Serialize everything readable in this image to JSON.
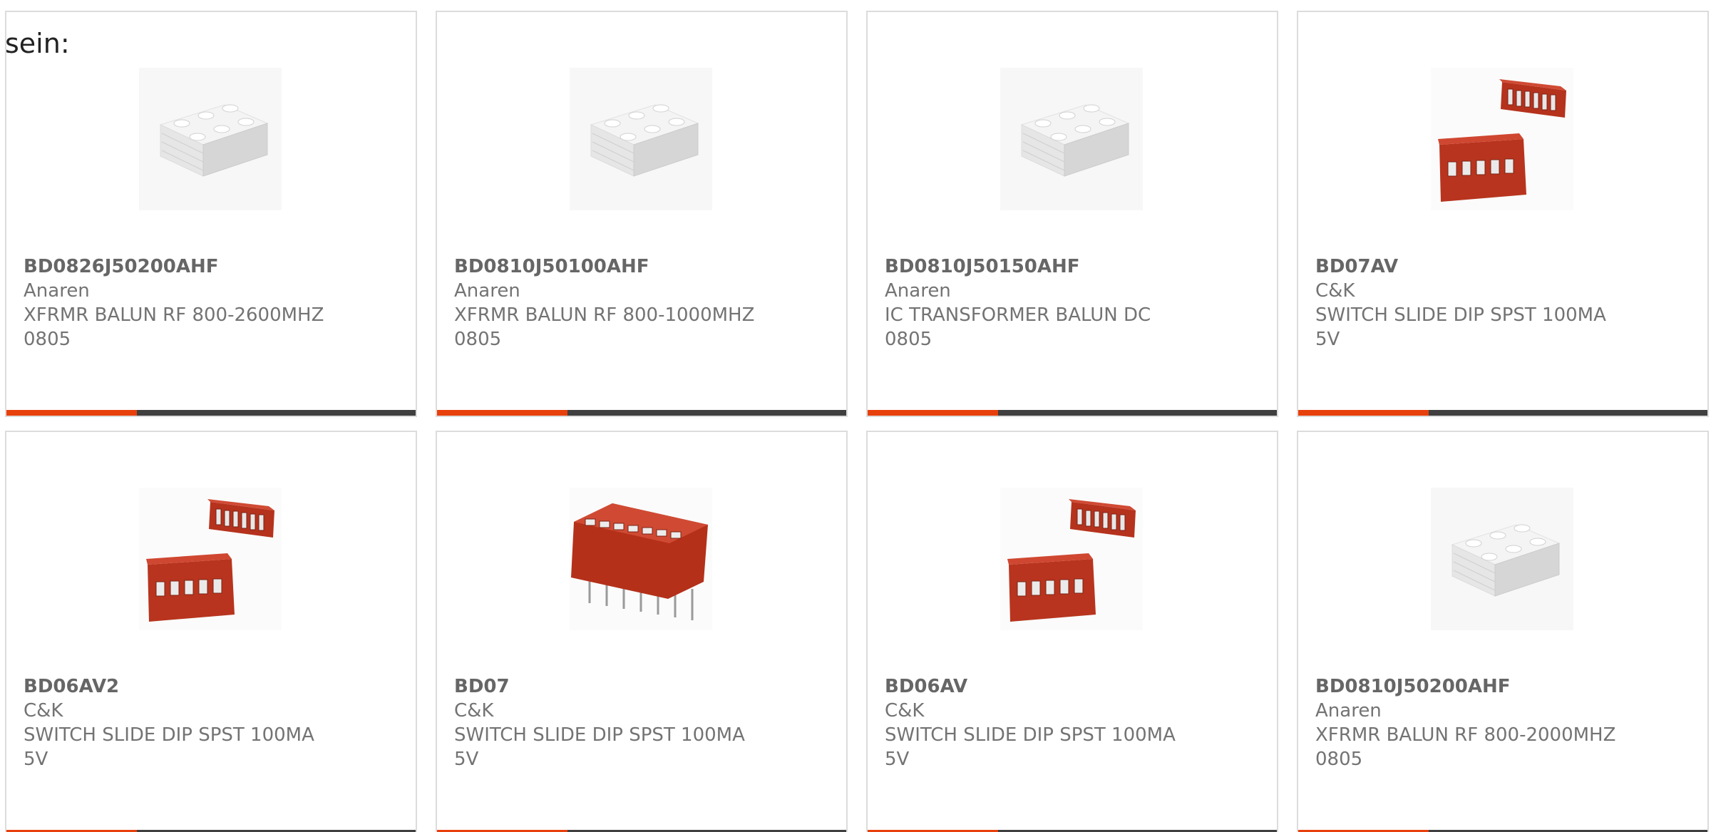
{
  "intro_text": "sein:",
  "colors": {
    "accent": "#e8400c",
    "bar": "#3f3f3f",
    "card_border": "#dcdcdc",
    "text": "#737373"
  },
  "products": [
    {
      "part_number": "BD0826J50200AHF",
      "manufacturer": "Anaren",
      "description_line1": "XFRMR BALUN RF 800-2600MHZ",
      "description_line2": "0805",
      "image": "balun-chip-image"
    },
    {
      "part_number": "BD0810J50100AHF",
      "manufacturer": "Anaren",
      "description_line1": "XFRMR BALUN RF 800-1000MHZ",
      "description_line2": "0805",
      "image": "balun-chip-image"
    },
    {
      "part_number": "BD0810J50150AHF",
      "manufacturer": "Anaren",
      "description_line1": "IC TRANSFORMER BALUN DC",
      "description_line2": "0805",
      "image": "balun-chip-image"
    },
    {
      "part_number": "BD07AV",
      "manufacturer": "C&K",
      "description_line1": "SWITCH SLIDE DIP SPST 100MA",
      "description_line2": "5V",
      "image": "dip-switch-pair-image"
    },
    {
      "part_number": "BD06AV2",
      "manufacturer": "C&K",
      "description_line1": "SWITCH SLIDE DIP SPST 100MA",
      "description_line2": "5V",
      "image": "dip-switch-pair-image"
    },
    {
      "part_number": "BD07",
      "manufacturer": "C&K",
      "description_line1": "SWITCH SLIDE DIP SPST 100MA",
      "description_line2": "5V",
      "image": "dip-switch-single-image"
    },
    {
      "part_number": "BD06AV",
      "manufacturer": "C&K",
      "description_line1": "SWITCH SLIDE DIP SPST 100MA",
      "description_line2": "5V",
      "image": "dip-switch-pair-image"
    },
    {
      "part_number": "BD0810J50200AHF",
      "manufacturer": "Anaren",
      "description_line1": "XFRMR BALUN RF 800-2000MHZ",
      "description_line2": "0805",
      "image": "balun-chip-image"
    }
  ]
}
